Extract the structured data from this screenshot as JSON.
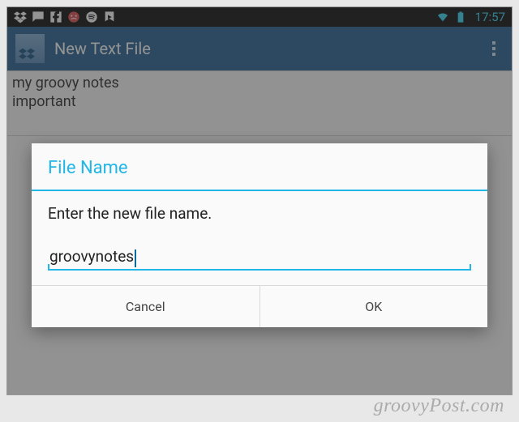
{
  "statusbar": {
    "time": "17:57"
  },
  "actionbar": {
    "title": "New Text File"
  },
  "editor": {
    "text": "my groovy notes\nimportant"
  },
  "dialog": {
    "title": "File Name",
    "message": "Enter the new file name.",
    "input_value": "groovynotes",
    "cancel_label": "Cancel",
    "ok_label": "OK"
  },
  "watermark": "groovyPost.com"
}
